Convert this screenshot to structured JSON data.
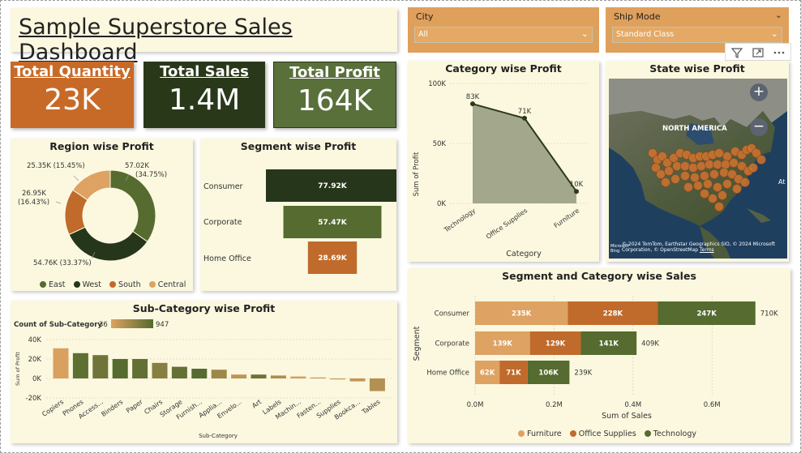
{
  "title": "Sample Superstore Sales Dashboard",
  "kpis": [
    {
      "label": "Total Quantity",
      "value": "23K",
      "color": "#c86a27"
    },
    {
      "label": "Total Sales",
      "value": "1.4M",
      "color": "#2a381a"
    },
    {
      "label": "Total Profit",
      "value": "164K",
      "color": "#59703a"
    }
  ],
  "slicers": {
    "city": {
      "label": "City",
      "value": "All"
    },
    "ship_mode": {
      "label": "Ship Mode",
      "value": "Standard Class"
    }
  },
  "colors": {
    "east": "#556b2f",
    "west": "#26361a",
    "south": "#c06a2b",
    "central": "#dea262",
    "furniture": "#dea262",
    "office_supplies": "#c06a2b",
    "technology": "#556b2f",
    "area_fill": "#a3a88d",
    "area_line": "#2a3a1a",
    "panel_bg": "#fbf8df",
    "map_bubble": "#d0732f"
  },
  "region_chart": {
    "title": "Region wise Profit",
    "slice_labels": [
      {
        "key": "east",
        "text_lines": [
          "57.02K",
          "(34.75%)"
        ]
      },
      {
        "key": "west",
        "text_lines": [
          "54.76K (33.37%)"
        ]
      },
      {
        "key": "south",
        "text_lines": [
          "26.95K",
          "(16.43%)"
        ]
      },
      {
        "key": "central",
        "text_lines": [
          "25.35K (15.45%)"
        ]
      }
    ],
    "legend": [
      "East",
      "West",
      "South",
      "Central"
    ]
  },
  "segment_chart": {
    "title": "Segment wise Profit",
    "categories": [
      "Consumer",
      "Corporate",
      "Home Office"
    ],
    "labels": [
      "77.92K",
      "57.47K",
      "28.69K"
    ]
  },
  "category_chart": {
    "title": "Category wise Profit",
    "ylabel": "Sum of Profit",
    "xlabel": "Category",
    "ticks": [
      "0K",
      "50K",
      "100K"
    ],
    "labels": [
      "83K",
      "71K",
      "10K"
    ]
  },
  "state_map": {
    "title": "State wise Profit",
    "region_label": "NORTH AMERICA",
    "attribution": "© 2024 TomTom, Earthstar Geographics SIO, © 2024 Microsoft Corporation, © OpenStreetMap",
    "terms": "Terms",
    "bing": "Microsoft Bing",
    "edge_text": "At"
  },
  "subcategory_chart": {
    "title": "Sub-Category wise Profit",
    "legend_title": "Count of Sub-Category",
    "legend_min": "36",
    "legend_max": "947",
    "ylabel": "Sum of Profit",
    "xlabel": "Sub-Category",
    "ticks": [
      "-20K",
      "0K",
      "20K",
      "40K"
    ]
  },
  "segcat_chart": {
    "title": "Segment and Category wise Sales",
    "ylabel": "Segment",
    "xlabel": "Sum of Sales",
    "ticks": [
      "0.0M",
      "0.2M",
      "0.4M",
      "0.6M"
    ],
    "legend": [
      "Furniture",
      "Office Supplies",
      "Technology"
    ],
    "segments": [
      "Consumer",
      "Corporate",
      "Home Office"
    ],
    "furniture_labels": [
      "235K",
      "139K",
      "62K"
    ],
    "office_labels": [
      "228K",
      "129K",
      "71K"
    ],
    "technology_labels": [
      "247K",
      "141K",
      "106K"
    ],
    "totals": [
      "710K",
      "409K",
      "239K"
    ]
  },
  "chart_data": [
    {
      "type": "pie",
      "title": "Region wise Profit",
      "categories": [
        "East",
        "West",
        "South",
        "Central"
      ],
      "values": [
        57.02,
        54.76,
        26.95,
        25.35
      ],
      "unit": "K"
    },
    {
      "type": "bar",
      "title": "Segment wise Profit",
      "categories": [
        "Consumer",
        "Corporate",
        "Home Office"
      ],
      "values": [
        77.92,
        57.47,
        28.69
      ],
      "unit": "K"
    },
    {
      "type": "area",
      "title": "Category wise Profit",
      "categories": [
        "Technology",
        "Office Supplies",
        "Furniture"
      ],
      "values": [
        83,
        71,
        10
      ],
      "xlabel": "Category",
      "ylabel": "Sum of Profit",
      "ylim": [
        0,
        100
      ],
      "unit": "K"
    },
    {
      "type": "bar",
      "title": "Sub-Category wise Profit",
      "categories": [
        "Copiers",
        "Phones",
        "Access...",
        "Binders",
        "Paper",
        "Chairs",
        "Storage",
        "Furnish...",
        "Applia...",
        "Envelo...",
        "Art",
        "Labels",
        "Machin...",
        "Fasten...",
        "Supplies",
        "Bookca...",
        "Tables"
      ],
      "values": [
        31,
        26,
        24,
        20,
        20,
        16,
        12,
        10,
        9,
        4,
        4,
        3,
        2,
        1,
        -1,
        -3,
        -13
      ],
      "counts": [
        68,
        889,
        775,
        947,
        860,
        617,
        846,
        957,
        466,
        254,
        796,
        364,
        115,
        217,
        190,
        228,
        319
      ],
      "xlabel": "Sub-Category",
      "ylabel": "Sum of Profit",
      "ylim": [
        -20,
        40
      ],
      "unit": "K"
    },
    {
      "type": "bar",
      "title": "Segment and Category wise Sales",
      "categories": [
        "Consumer",
        "Corporate",
        "Home Office"
      ],
      "series": [
        {
          "name": "Furniture",
          "values": [
            235,
            139,
            62
          ]
        },
        {
          "name": "Office Supplies",
          "values": [
            228,
            129,
            71
          ]
        },
        {
          "name": "Technology",
          "values": [
            247,
            141,
            106
          ]
        }
      ],
      "totals": [
        710,
        409,
        239
      ],
      "xlabel": "Sum of Sales",
      "ylabel": "Segment",
      "xlim": [
        0,
        0.7
      ],
      "unit": "K"
    }
  ]
}
